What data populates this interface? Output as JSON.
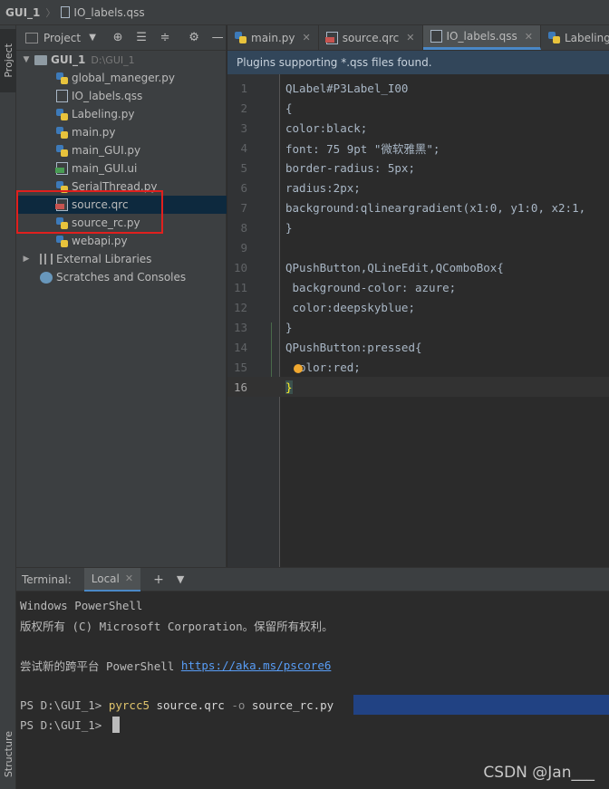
{
  "navbar": {
    "project": "GUI_1",
    "file": "IO_labels.qss"
  },
  "leftstrip": {
    "project_tab": "Project",
    "structure_tab": "Structure"
  },
  "project_panel": {
    "title": "Project",
    "tree": {
      "root_name": "GUI_1",
      "root_path": "D:\\GUI_1",
      "files": [
        {
          "name": "global_maneger.py",
          "type": "py"
        },
        {
          "name": "IO_labels.qss",
          "type": "qss"
        },
        {
          "name": "Labeling.py",
          "type": "py"
        },
        {
          "name": "main.py",
          "type": "py"
        },
        {
          "name": "main_GUI.py",
          "type": "py"
        },
        {
          "name": "main_GUI.ui",
          "type": "ui"
        },
        {
          "name": "SerialThread.py",
          "type": "py"
        },
        {
          "name": "source.qrc",
          "type": "qrc"
        },
        {
          "name": "source_rc.py",
          "type": "py"
        },
        {
          "name": "webapi.py",
          "type": "py"
        }
      ],
      "external_libraries": "External Libraries",
      "scratches": "Scratches and Consoles"
    }
  },
  "editor": {
    "tabs": [
      {
        "label": "main.py",
        "icon": "python-file-icon"
      },
      {
        "label": "source.qrc",
        "icon": "qrc-file-icon"
      },
      {
        "label": "IO_labels.qss",
        "icon": "qss-file-icon"
      },
      {
        "label": "Labeling.py",
        "icon": "python-file-icon"
      }
    ],
    "active_tab": "IO_labels.qss",
    "banner": "Plugins supporting *.qss files found.",
    "lines": [
      {
        "n": "1",
        "text": "QLabel#P3Label_I00"
      },
      {
        "n": "2",
        "text": "{"
      },
      {
        "n": "3",
        "text": "color:black;"
      },
      {
        "n": "4",
        "text": "font: 75 9pt \"微软雅黑\";"
      },
      {
        "n": "5",
        "text": "border-radius: 5px;"
      },
      {
        "n": "6",
        "text": "radius:2px;"
      },
      {
        "n": "7",
        "text": "background:qlineargradient(x1:0, y1:0, x2:1,"
      },
      {
        "n": "8",
        "text": "}"
      },
      {
        "n": "9",
        "text": ""
      },
      {
        "n": "10",
        "text": "QPushButton,QLineEdit,QComboBox{"
      },
      {
        "n": "11",
        "text": " background-color: azure;"
      },
      {
        "n": "12",
        "text": " color:deepskyblue;"
      },
      {
        "n": "13",
        "text": "}"
      },
      {
        "n": "14",
        "text": "QPushButton:pressed{"
      },
      {
        "n": "15",
        "text": "  olor:red;"
      },
      {
        "n": "16",
        "text": "}"
      }
    ]
  },
  "terminal": {
    "title": "Terminal:",
    "tab": "Local",
    "lines": {
      "l1": "Windows PowerShell",
      "l2": "版权所有 (C) Microsoft Corporation。保留所有权利。",
      "l3_prefix": "尝试新的跨平台 PowerShell ",
      "l3_link": "https://aka.ms/pscore6",
      "prompt": "PS D:\\GUI_1> ",
      "cmd_name": "pyrcc5",
      "cmd_arg1": " source.qrc ",
      "cmd_flag": "-o",
      "cmd_arg2": " source_rc.py"
    }
  },
  "watermark": "CSDN @Jan___",
  "colors": {
    "accent": "#4a88c7",
    "highlight_box": "#e0201e",
    "selection": "#214283"
  }
}
